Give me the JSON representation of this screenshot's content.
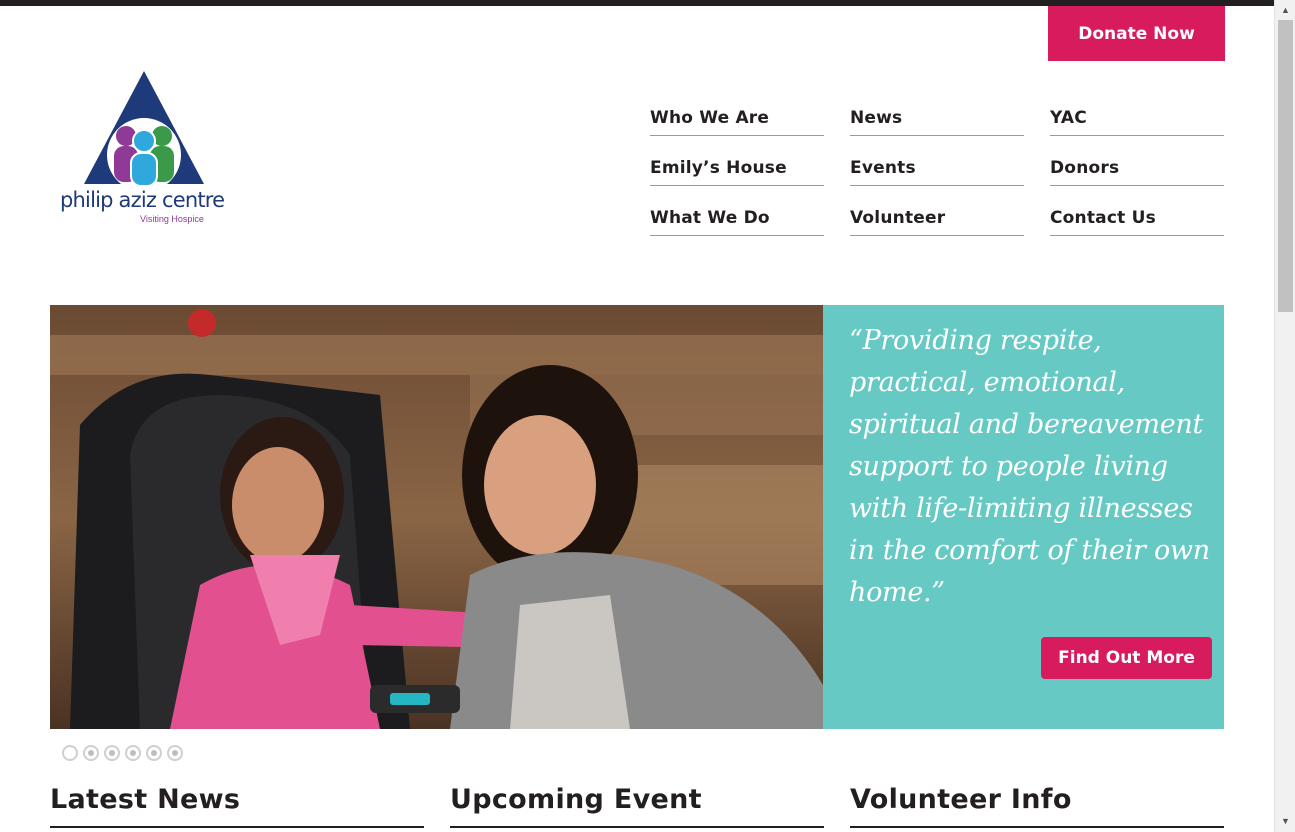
{
  "header": {
    "donate_label": "Donate Now"
  },
  "logo": {
    "name": "philip aziz centre",
    "subtitle": "Visiting Hospice"
  },
  "nav": {
    "items": [
      {
        "label": "Who We Are"
      },
      {
        "label": "News"
      },
      {
        "label": "YAC"
      },
      {
        "label": "Emily’s House"
      },
      {
        "label": "Events"
      },
      {
        "label": "Donors"
      },
      {
        "label": "What We Do"
      },
      {
        "label": "Volunteer"
      },
      {
        "label": "Contact Us"
      }
    ]
  },
  "hero": {
    "quote": "“Providing respite, practical, emotional, spiritual and bereavement support to people living with life-limiting illnesses in the comfort of their own home.”",
    "cta_label": "Find Out More",
    "slides_total": 6,
    "active_slide": 1
  },
  "sections": {
    "latest_news": "Latest News",
    "upcoming_event": "Upcoming Event",
    "volunteer_info": "Volunteer Info"
  },
  "colors": {
    "brand_pink": "#d81b5c",
    "teal": "#67c9c4",
    "logo_blue": "#1f3a7a",
    "logo_purple": "#8e3a96",
    "logo_green": "#3a9a4a"
  },
  "icons": {
    "scroll_up": "scroll-up-arrow-icon",
    "scroll_down": "scroll-down-arrow-icon"
  }
}
